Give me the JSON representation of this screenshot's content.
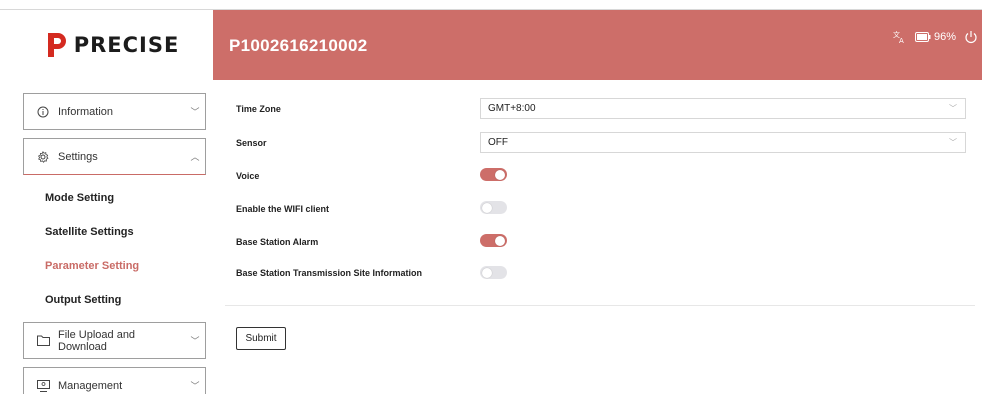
{
  "brand": {
    "logo_text": "PRECISE",
    "accent_color": "#cd6e69"
  },
  "header": {
    "device_id": "P1002616210002",
    "battery_level": "96%"
  },
  "sidebar": {
    "menus": [
      {
        "label": "Information",
        "icon": "info-icon"
      },
      {
        "label": "Settings",
        "icon": "gear-icon"
      },
      {
        "label": "File Upload and Download",
        "icon": "folder-icon"
      },
      {
        "label": "Management",
        "icon": "management-icon"
      }
    ],
    "submenu": [
      {
        "label": "Mode Setting",
        "active": false
      },
      {
        "label": "Satellite Settings",
        "active": false
      },
      {
        "label": "Parameter Setting",
        "active": true
      },
      {
        "label": "Output Setting",
        "active": false
      }
    ]
  },
  "form": {
    "time_zone": {
      "label": "Time Zone",
      "value": "GMT+8:00"
    },
    "sensor": {
      "label": "Sensor",
      "value": "OFF"
    },
    "voice": {
      "label": "Voice",
      "enabled": true
    },
    "wifi_client": {
      "label": "Enable the WIFI client",
      "enabled": false
    },
    "base_station_alarm": {
      "label": "Base Station Alarm",
      "enabled": true
    },
    "base_station_tx_info": {
      "label": "Base Station Transmission Site Information",
      "enabled": false
    },
    "submit_label": "Submit"
  }
}
